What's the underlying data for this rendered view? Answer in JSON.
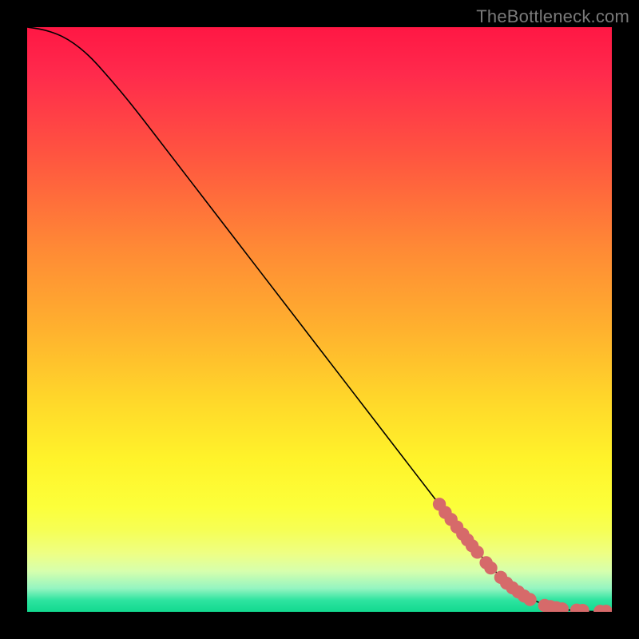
{
  "attribution": "TheBottleneck.com",
  "colors": {
    "curve": "#000000",
    "marker_fill": "#d66a6a",
    "marker_stroke": "#aa4a4a",
    "background_black": "#000000"
  },
  "chart_data": {
    "type": "line",
    "title": "",
    "xlabel": "",
    "ylabel": "",
    "xlim": [
      0,
      100
    ],
    "ylim": [
      0,
      100
    ],
    "curve": {
      "x": [
        0,
        2,
        4,
        6,
        8,
        10,
        12,
        16,
        20,
        30,
        40,
        50,
        60,
        70,
        76,
        80,
        84,
        88,
        92,
        96,
        100
      ],
      "y": [
        100,
        99.7,
        99.2,
        98.4,
        97.2,
        95.6,
        93.6,
        89,
        84,
        71,
        58,
        45,
        32,
        19,
        11.5,
        7,
        3.6,
        1.4,
        0.4,
        0.1,
        0
      ]
    },
    "markers": [
      {
        "x": 70.5,
        "y": 18.4
      },
      {
        "x": 71.5,
        "y": 17.0
      },
      {
        "x": 72.5,
        "y": 15.8
      },
      {
        "x": 73.5,
        "y": 14.5
      },
      {
        "x": 74.5,
        "y": 13.3
      },
      {
        "x": 75.3,
        "y": 12.3
      },
      {
        "x": 76.1,
        "y": 11.3
      },
      {
        "x": 77.0,
        "y": 10.2
      },
      {
        "x": 78.5,
        "y": 8.4
      },
      {
        "x": 79.3,
        "y": 7.5
      },
      {
        "x": 81.0,
        "y": 5.9
      },
      {
        "x": 82.0,
        "y": 4.9
      },
      {
        "x": 83.0,
        "y": 4.1
      },
      {
        "x": 84.0,
        "y": 3.4
      },
      {
        "x": 85.0,
        "y": 2.7
      },
      {
        "x": 86.0,
        "y": 2.1
      },
      {
        "x": 88.5,
        "y": 1.1
      },
      {
        "x": 89.5,
        "y": 0.9
      },
      {
        "x": 90.5,
        "y": 0.7
      },
      {
        "x": 91.5,
        "y": 0.5
      },
      {
        "x": 94.0,
        "y": 0.3
      },
      {
        "x": 95.0,
        "y": 0.25
      },
      {
        "x": 98.0,
        "y": 0.1
      },
      {
        "x": 99.0,
        "y": 0.1
      }
    ]
  }
}
